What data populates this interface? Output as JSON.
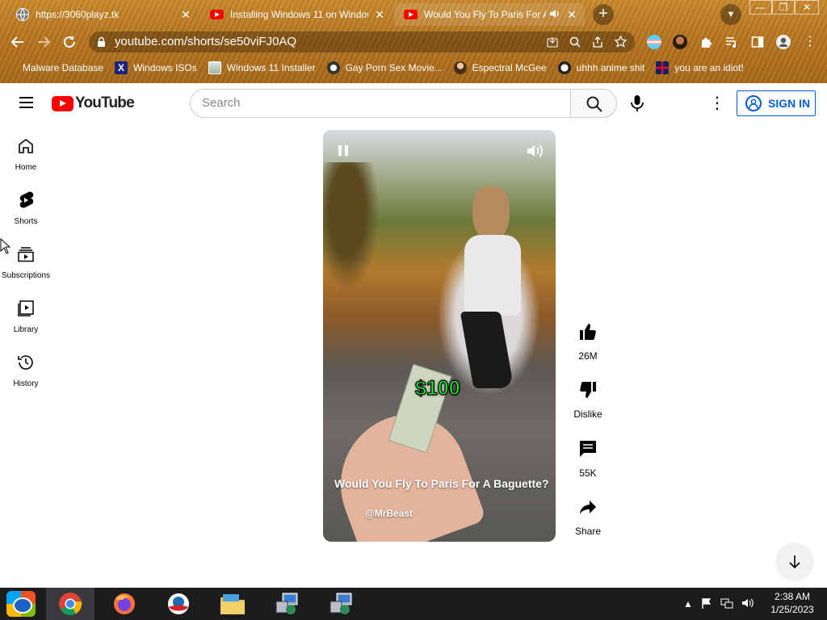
{
  "browser": {
    "tabs": [
      {
        "title": "https://3060playz.tk",
        "close": "✕"
      },
      {
        "title": "Installing Windows 11 on Window…",
        "close": "✕"
      },
      {
        "title": "Would You Fly To Paris For A…",
        "close": "✕"
      }
    ],
    "new_tab": "+",
    "window_controls": [
      "—",
      "❐",
      "✕"
    ],
    "url": "youtube.com/shorts/se50viFJ0AQ",
    "bookmarks": [
      {
        "label": "Malware Database"
      },
      {
        "label": "Windows ISOs"
      },
      {
        "label": "Windows 11 Installer"
      },
      {
        "label": "Gay Porn Sex Movie..."
      },
      {
        "label": "Espectral McGee"
      },
      {
        "label": "uhhh anime shit"
      },
      {
        "label": "you are an idiot!"
      }
    ]
  },
  "youtube": {
    "logo_text": "YouTube",
    "search_placeholder": "Search",
    "sign_in": "SIGN IN",
    "sidebar": [
      {
        "label": "Home",
        "icon": "home-icon"
      },
      {
        "label": "Shorts",
        "icon": "shorts-icon"
      },
      {
        "label": "Subscriptions",
        "icon": "subscriptions-icon"
      },
      {
        "label": "Library",
        "icon": "library-icon"
      },
      {
        "label": "History",
        "icon": "history-icon"
      }
    ],
    "video": {
      "overlay_text": "$100",
      "title": "Would You Fly To Paris For A Baguette?",
      "channel": "@MrBeast"
    },
    "actions": [
      {
        "label": "26M",
        "icon": "like-icon"
      },
      {
        "label": "Dislike",
        "icon": "dislike-icon"
      },
      {
        "label": "55K",
        "icon": "comment-icon"
      },
      {
        "label": "Share",
        "icon": "share-icon"
      }
    ]
  },
  "taskbar": {
    "time": "2:38 AM",
    "date": "1/25/2023"
  },
  "colors": {
    "youtube_red": "#ff0000",
    "signin_blue": "#065fd4",
    "chrome_theme": "#b7761f"
  }
}
